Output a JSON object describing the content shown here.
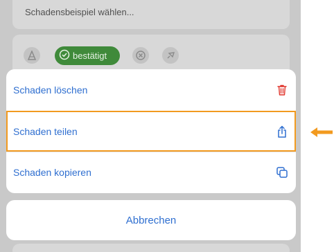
{
  "background": {
    "placeholder": "Schadensbeispiel wählen...",
    "status_label": "bestätigt",
    "icons": [
      "cone-icon",
      "check-circle-icon",
      "x-circle-icon",
      "pin-icon"
    ]
  },
  "action_sheet": {
    "items": [
      {
        "label": "Schaden löschen",
        "icon": "trash-icon",
        "color": "#e0342b"
      },
      {
        "label": "Schaden teilen",
        "icon": "share-icon",
        "color": "#2f6fd0",
        "highlighted": true
      },
      {
        "label": "Schaden kopieren",
        "icon": "copy-icon",
        "color": "#2f6fd0"
      }
    ],
    "cancel_label": "Abbrechen"
  },
  "annotation": {
    "color": "#f29a1f",
    "icon": "arrow-left-icon"
  },
  "colors": {
    "accent": "#2f6fd0",
    "destructive": "#e0342b",
    "status_green": "#3f8a3a"
  }
}
